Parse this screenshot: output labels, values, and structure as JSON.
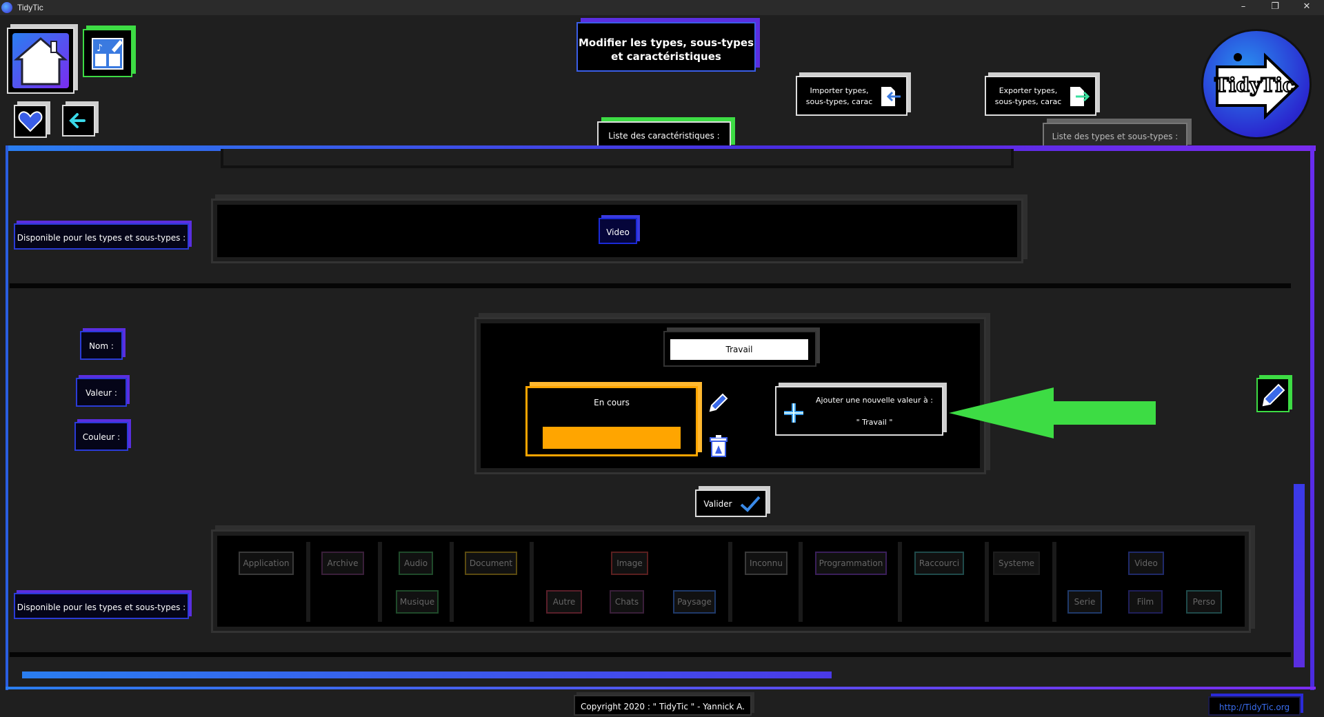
{
  "window": {
    "title": "TidyTic",
    "minimize": "–",
    "maximize": "❐",
    "close": "✕"
  },
  "header": {
    "page_title_line1": "Modifier les types, sous-types",
    "page_title_line2": "et caractéristiques",
    "import_line1": "Importer types,",
    "import_line2": "sous-types, carac",
    "export_line1": "Exporter types,",
    "export_line2": "sous-types, carac",
    "tab_caracteristiques": "Liste des caractéristiques :",
    "tab_types": "Liste des types et sous-types :",
    "logo_text": "TidyTic"
  },
  "upper_section": {
    "available_label": "Disponible pour les types et sous-types :",
    "selected_types": [
      "Video"
    ]
  },
  "form": {
    "name_label": "Nom :",
    "value_label": "Valeur :",
    "color_label": "Couleur :",
    "name_value": "Travail",
    "current_value": "En cours",
    "current_value_color": "#ffa500",
    "add_value_line1": "Ajouter une nouvelle valeur à :",
    "add_value_line2": "\" Travail \"",
    "validate": "Valider"
  },
  "lower_section": {
    "available_label": "Disponible pour les types et sous-types :",
    "types": [
      {
        "name": "Application",
        "color": "#5a5a5a"
      },
      {
        "name": "Archive",
        "color": "#4a1f4a"
      },
      {
        "name": "Audio",
        "color": "#1f5a2a"
      },
      {
        "name": "Document",
        "color": "#6a5a10"
      },
      {
        "name": "Image",
        "color": "#6a1f1f"
      },
      {
        "name": "Inconnu",
        "color": "#5a5a5a"
      },
      {
        "name": "Programmation",
        "color": "#4a1f6a"
      },
      {
        "name": "Raccourci",
        "color": "#1f5a5a"
      },
      {
        "name": "Systeme",
        "color": "#2a2a2a"
      },
      {
        "name": "Video",
        "color": "#1f2a6a"
      }
    ],
    "subtypes": [
      {
        "name": "Musique",
        "color": "#1f5a2a"
      },
      {
        "name": "Autre",
        "color": "#6a1f2a"
      },
      {
        "name": "Chats",
        "color": "#4a1f4a"
      },
      {
        "name": "Paysage",
        "color": "#1f3a6a"
      },
      {
        "name": "Serie",
        "color": "#1f3a6a"
      },
      {
        "name": "Film",
        "color": "#1f1f5a"
      },
      {
        "name": "Perso",
        "color": "#1f5a5a"
      }
    ]
  },
  "footer": {
    "copyright": "Copyright 2020 : \" TidyTic \" - Yannick A.",
    "url": "http://TidyTic.org"
  },
  "colors": {
    "accent_blue": "#2a7ef0",
    "accent_purple": "#6a2cf0",
    "arrow_green": "#3ddc44",
    "orange": "#ffa500"
  }
}
